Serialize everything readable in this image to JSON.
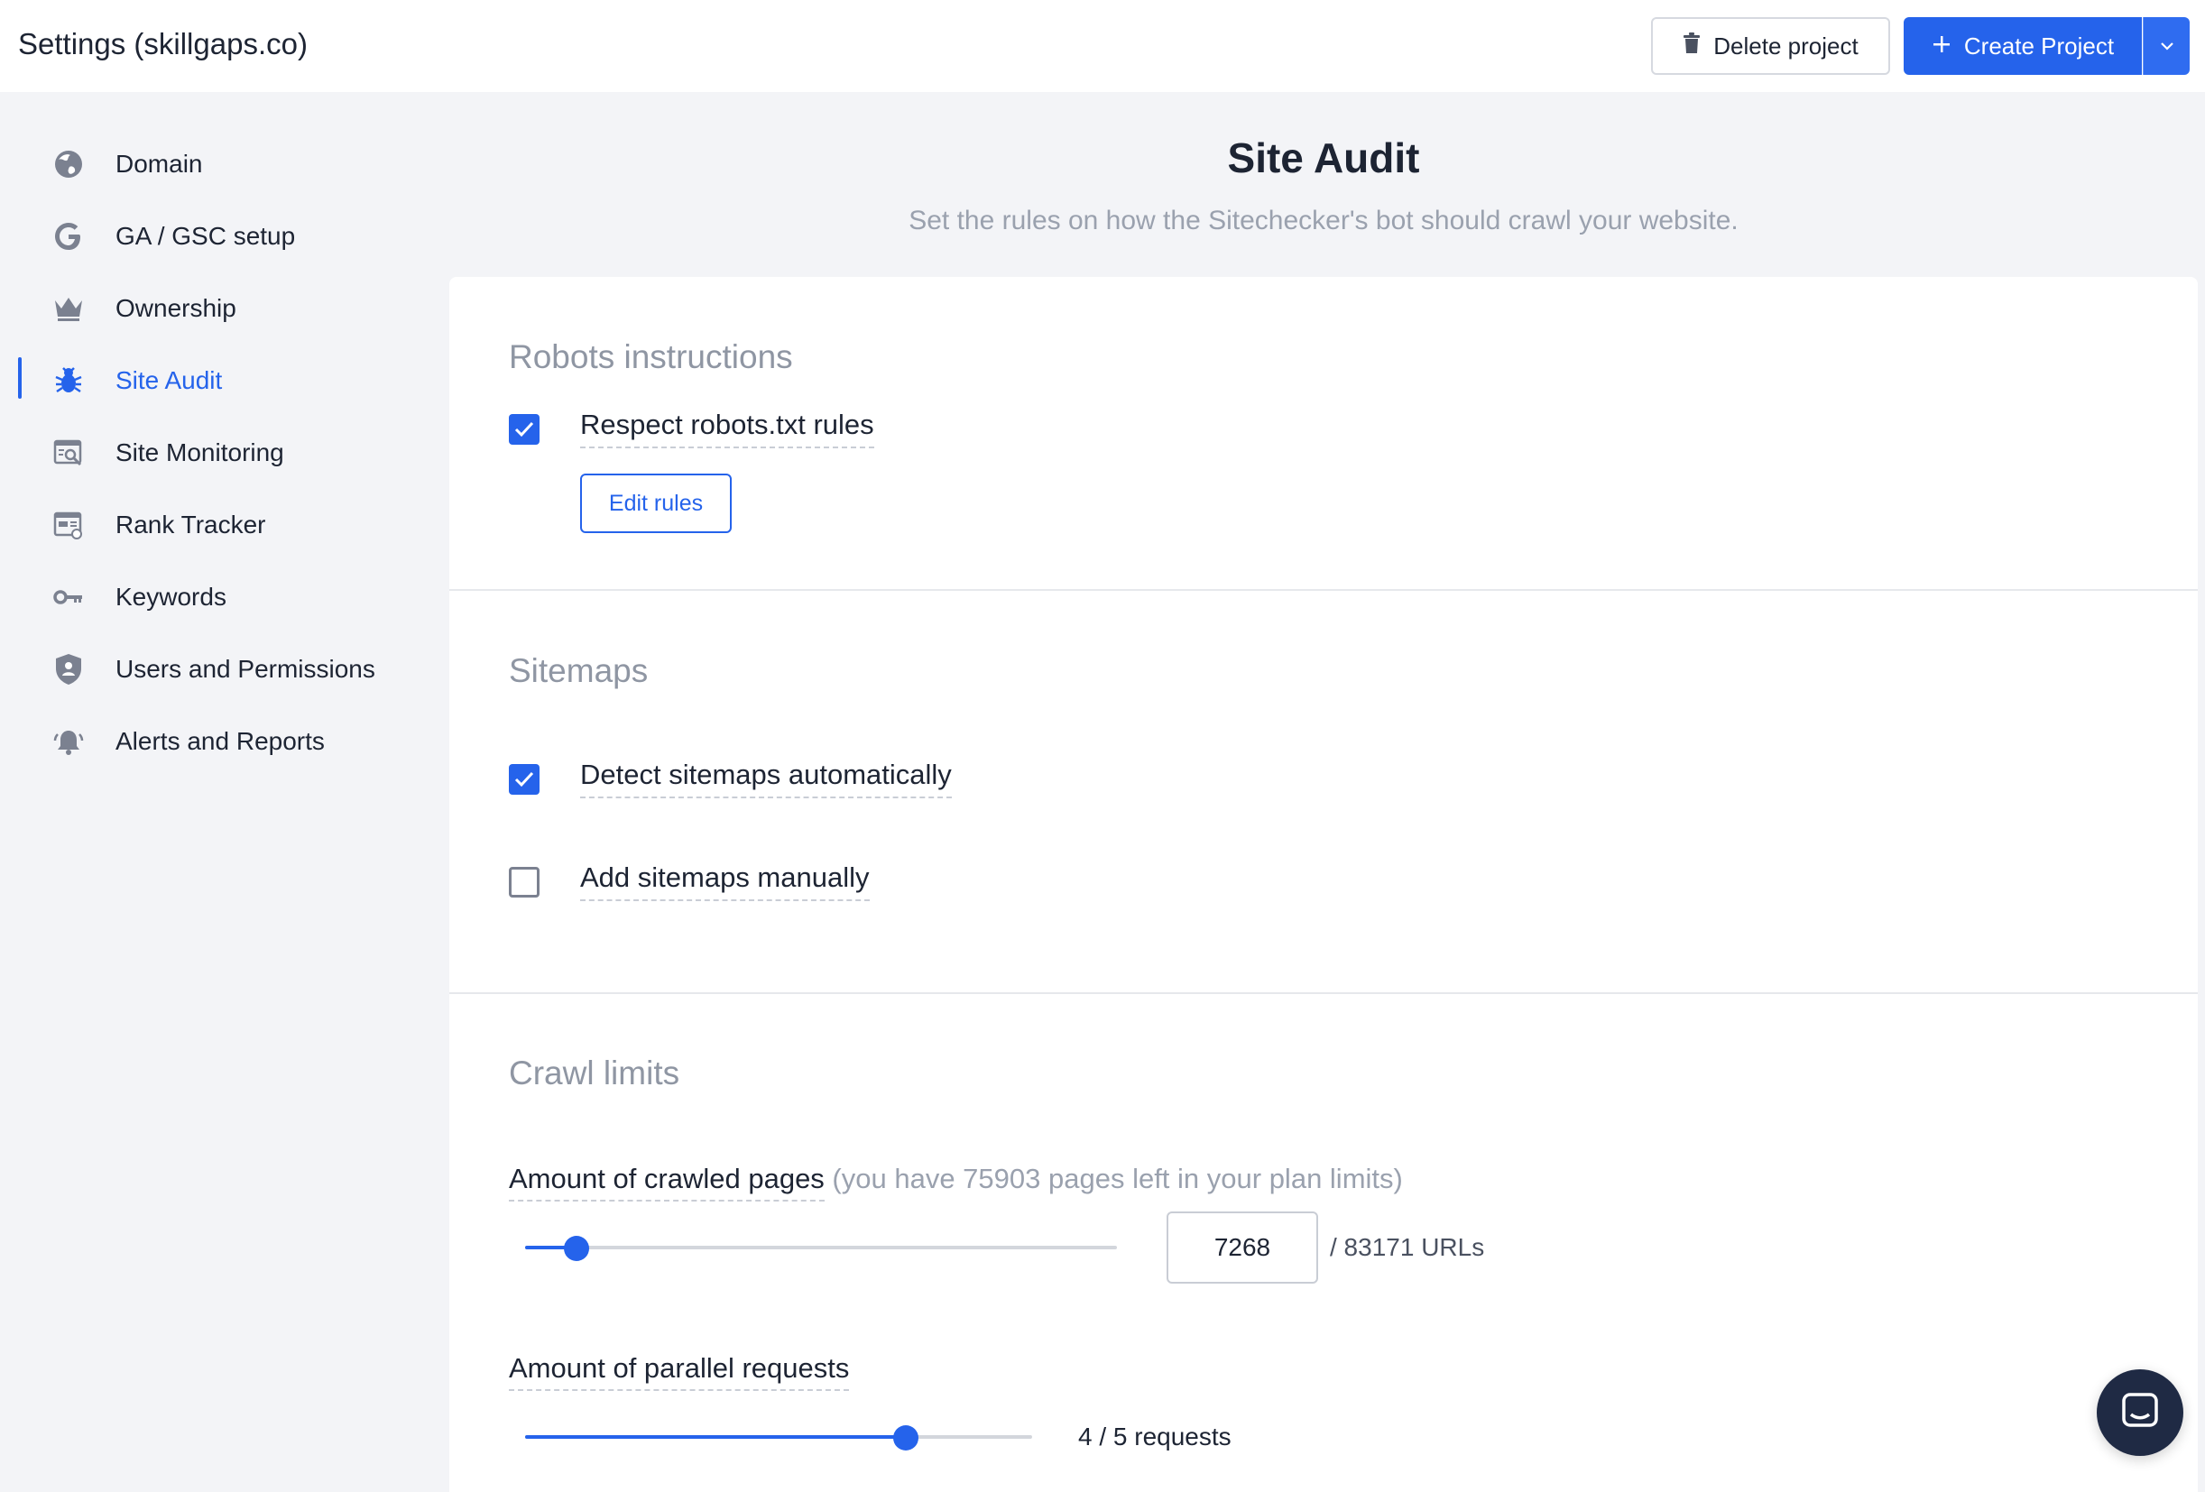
{
  "header": {
    "title": "Settings (skillgaps.co)",
    "delete_label": "Delete project",
    "create_label": "Create Project"
  },
  "sidebar": {
    "items": [
      {
        "label": "Domain",
        "icon": "globe-icon"
      },
      {
        "label": "GA / GSC setup",
        "icon": "google-icon"
      },
      {
        "label": "Ownership",
        "icon": "crown-icon"
      },
      {
        "label": "Site Audit",
        "icon": "bug-icon",
        "active": true
      },
      {
        "label": "Site Monitoring",
        "icon": "monitor-search-icon"
      },
      {
        "label": "Rank Tracker",
        "icon": "rank-tracker-icon"
      },
      {
        "label": "Keywords",
        "icon": "key-icon"
      },
      {
        "label": "Users and Permissions",
        "icon": "shield-user-icon"
      },
      {
        "label": "Alerts and Reports",
        "icon": "bell-icon"
      }
    ]
  },
  "main": {
    "title": "Site Audit",
    "subtitle": "Set the rules on how the Sitechecker's bot should crawl your website.",
    "robots": {
      "section_title": "Robots instructions",
      "respect_label": "Respect robots.txt rules",
      "respect_checked": true,
      "edit_label": "Edit rules"
    },
    "sitemaps": {
      "section_title": "Sitemaps",
      "detect_label": "Detect sitemaps automatically",
      "detect_checked": true,
      "manual_label": "Add sitemaps manually",
      "manual_checked": false
    },
    "crawl_limits": {
      "section_title": "Crawl limits",
      "pages_label": "Amount of crawled pages",
      "pages_hint": " (you have 75903 pages left in your plan limits)",
      "pages_value": "7268",
      "pages_max_text": "/ 83171 URLs",
      "pages_fraction": 0.087,
      "parallel_label": "Amount of parallel requests",
      "parallel_text": "4 / 5 requests",
      "parallel_fraction": 0.75
    }
  },
  "colors": {
    "accent": "#2563eb",
    "text": "#1d2433",
    "muted": "#9aa1ae"
  }
}
